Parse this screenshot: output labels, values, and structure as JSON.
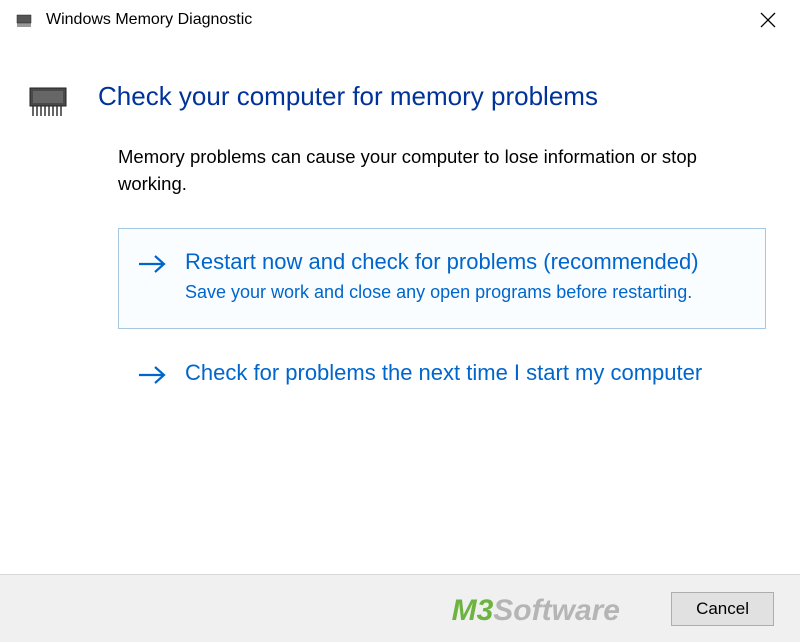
{
  "titlebar": {
    "title": "Windows Memory Diagnostic"
  },
  "main": {
    "heading": "Check your computer for memory problems",
    "description": "Memory problems can cause your computer to lose information or stop working."
  },
  "options": [
    {
      "title": "Restart now and check for problems (recommended)",
      "description": "Save your work and close any open programs before restarting.",
      "highlighted": true
    },
    {
      "title": "Check for problems the next time I start my computer",
      "description": "",
      "highlighted": false
    }
  ],
  "footer": {
    "cancel_label": "Cancel"
  },
  "watermark": {
    "part1": "M3",
    "part2": "Software"
  }
}
